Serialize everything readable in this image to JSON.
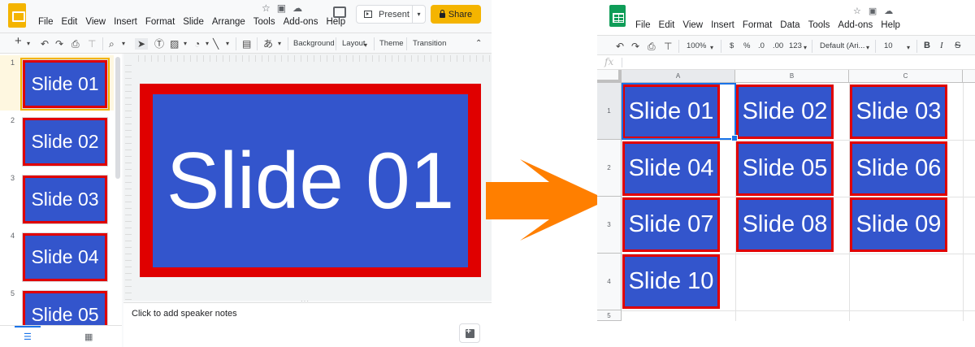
{
  "slides_app": {
    "menu": [
      "File",
      "Edit",
      "View",
      "Insert",
      "Format",
      "Slide",
      "Arrange",
      "Tools",
      "Add-ons",
      "Help"
    ],
    "present_label": "Present",
    "share_label": "Share",
    "toolbar": {
      "background_label": "Background",
      "layout_label": "Layout",
      "theme_label": "Theme",
      "transition_label": "Transition",
      "input_tool_label": "あ"
    },
    "thumbnails": [
      {
        "num": "1",
        "text": "Slide 01"
      },
      {
        "num": "2",
        "text": "Slide 02"
      },
      {
        "num": "3",
        "text": "Slide 03"
      },
      {
        "num": "4",
        "text": "Slide 04"
      },
      {
        "num": "5",
        "text": "Slide 05"
      }
    ],
    "current_slide_text": "Slide 01",
    "speaker_notes_placeholder": "Click to add speaker notes",
    "colors": {
      "slide_border": "#e00000",
      "slide_fill": "#3355cc",
      "brand": "#f4b400"
    }
  },
  "sheets_app": {
    "menu": [
      "File",
      "Edit",
      "View",
      "Insert",
      "Format",
      "Data",
      "Tools",
      "Add-ons",
      "Help"
    ],
    "toolbar": {
      "zoom": "100%",
      "currency": "$",
      "percent": "%",
      "dec_less": ".0",
      "dec_more": ".00",
      "number_format": "123",
      "font": "Default (Ari...",
      "font_size": "10",
      "bold": "B",
      "italic": "I"
    },
    "fx_label": "fx",
    "columns": [
      "A",
      "B",
      "C"
    ],
    "rows": [
      "1",
      "2",
      "3",
      "4",
      "5"
    ],
    "cells": [
      {
        "text": "Slide 01"
      },
      {
        "text": "Slide 02"
      },
      {
        "text": "Slide 03"
      },
      {
        "text": "Slide 04"
      },
      {
        "text": "Slide 05"
      },
      {
        "text": "Slide 06"
      },
      {
        "text": "Slide 07"
      },
      {
        "text": "Slide 08"
      },
      {
        "text": "Slide 09"
      },
      {
        "text": "Slide 10"
      }
    ],
    "colors": {
      "brand": "#0f9d58",
      "selection": "#1a73e8"
    }
  },
  "arrow_color": "#ff7f00"
}
